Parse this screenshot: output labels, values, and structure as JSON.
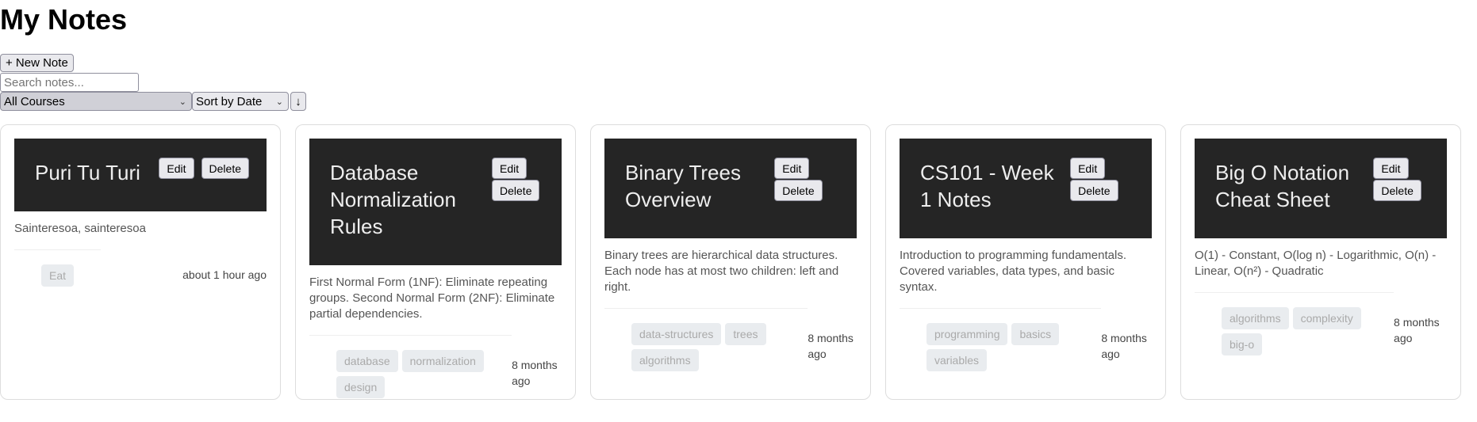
{
  "page_title": "My Notes",
  "toolbar": {
    "new_note_label": "+ New Note",
    "search_placeholder": "Search notes...",
    "search_value": "",
    "course_filter": "All Courses",
    "sort_by": "Sort by Date",
    "sort_direction": "↓"
  },
  "notes": [
    {
      "title": "Puri Tu Turi",
      "content": "Sainteresoa, sainteresoa",
      "tags": [
        "Eat"
      ],
      "time": "about 1 hour ago",
      "edit": "Edit",
      "delete": "Delete"
    },
    {
      "title": "Database Normalization Rules",
      "content": "First Normal Form (1NF): Eliminate repeating groups. Second Normal Form (2NF): Eliminate partial dependencies.",
      "tags": [
        "database",
        "normalization",
        "design"
      ],
      "time": "8 months ago",
      "edit": "Edit",
      "delete": "Delete"
    },
    {
      "title": "Binary Trees Overview",
      "content": "Binary trees are hierarchical data structures. Each node has at most two children: left and right.",
      "tags": [
        "data-structures",
        "trees",
        "algorithms"
      ],
      "time": "8 months ago",
      "edit": "Edit",
      "delete": "Delete"
    },
    {
      "title": "CS101 - Week 1 Notes",
      "content": "Introduction to programming fundamentals. Covered variables, data types, and basic syntax.",
      "tags": [
        "programming",
        "basics",
        "variables"
      ],
      "time": "8 months ago",
      "edit": "Edit",
      "delete": "Delete"
    },
    {
      "title": "Big O Notation Cheat Sheet",
      "content": "O(1) - Constant, O(log n) - Logarithmic, O(n) - Linear, O(n²) - Quadratic",
      "tags": [
        "algorithms",
        "complexity",
        "big-o"
      ],
      "time": "8 months ago",
      "edit": "Edit",
      "delete": "Delete"
    }
  ]
}
